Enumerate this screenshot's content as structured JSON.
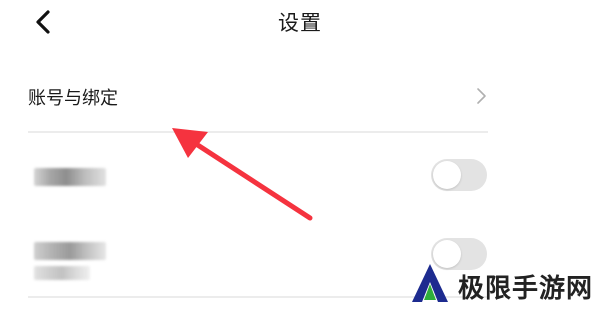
{
  "header": {
    "title": "设置"
  },
  "settings": {
    "items": [
      {
        "label": "账号与绑定",
        "type": "navigate"
      },
      {
        "label": "",
        "type": "toggle",
        "on": false
      },
      {
        "label": "",
        "type": "toggle",
        "on": false
      }
    ]
  },
  "watermark": {
    "text": "极限手游网"
  },
  "colors": {
    "annotation_arrow": "#f5333f",
    "toggle_off_track": "#e3e3e3",
    "divider": "#ececec",
    "watermark_logo": "#1d2b8f",
    "watermark_logo_accent": "#2fae3b"
  },
  "icons": {
    "back": "chevron-left-icon",
    "navigate": "chevron-right-icon"
  }
}
